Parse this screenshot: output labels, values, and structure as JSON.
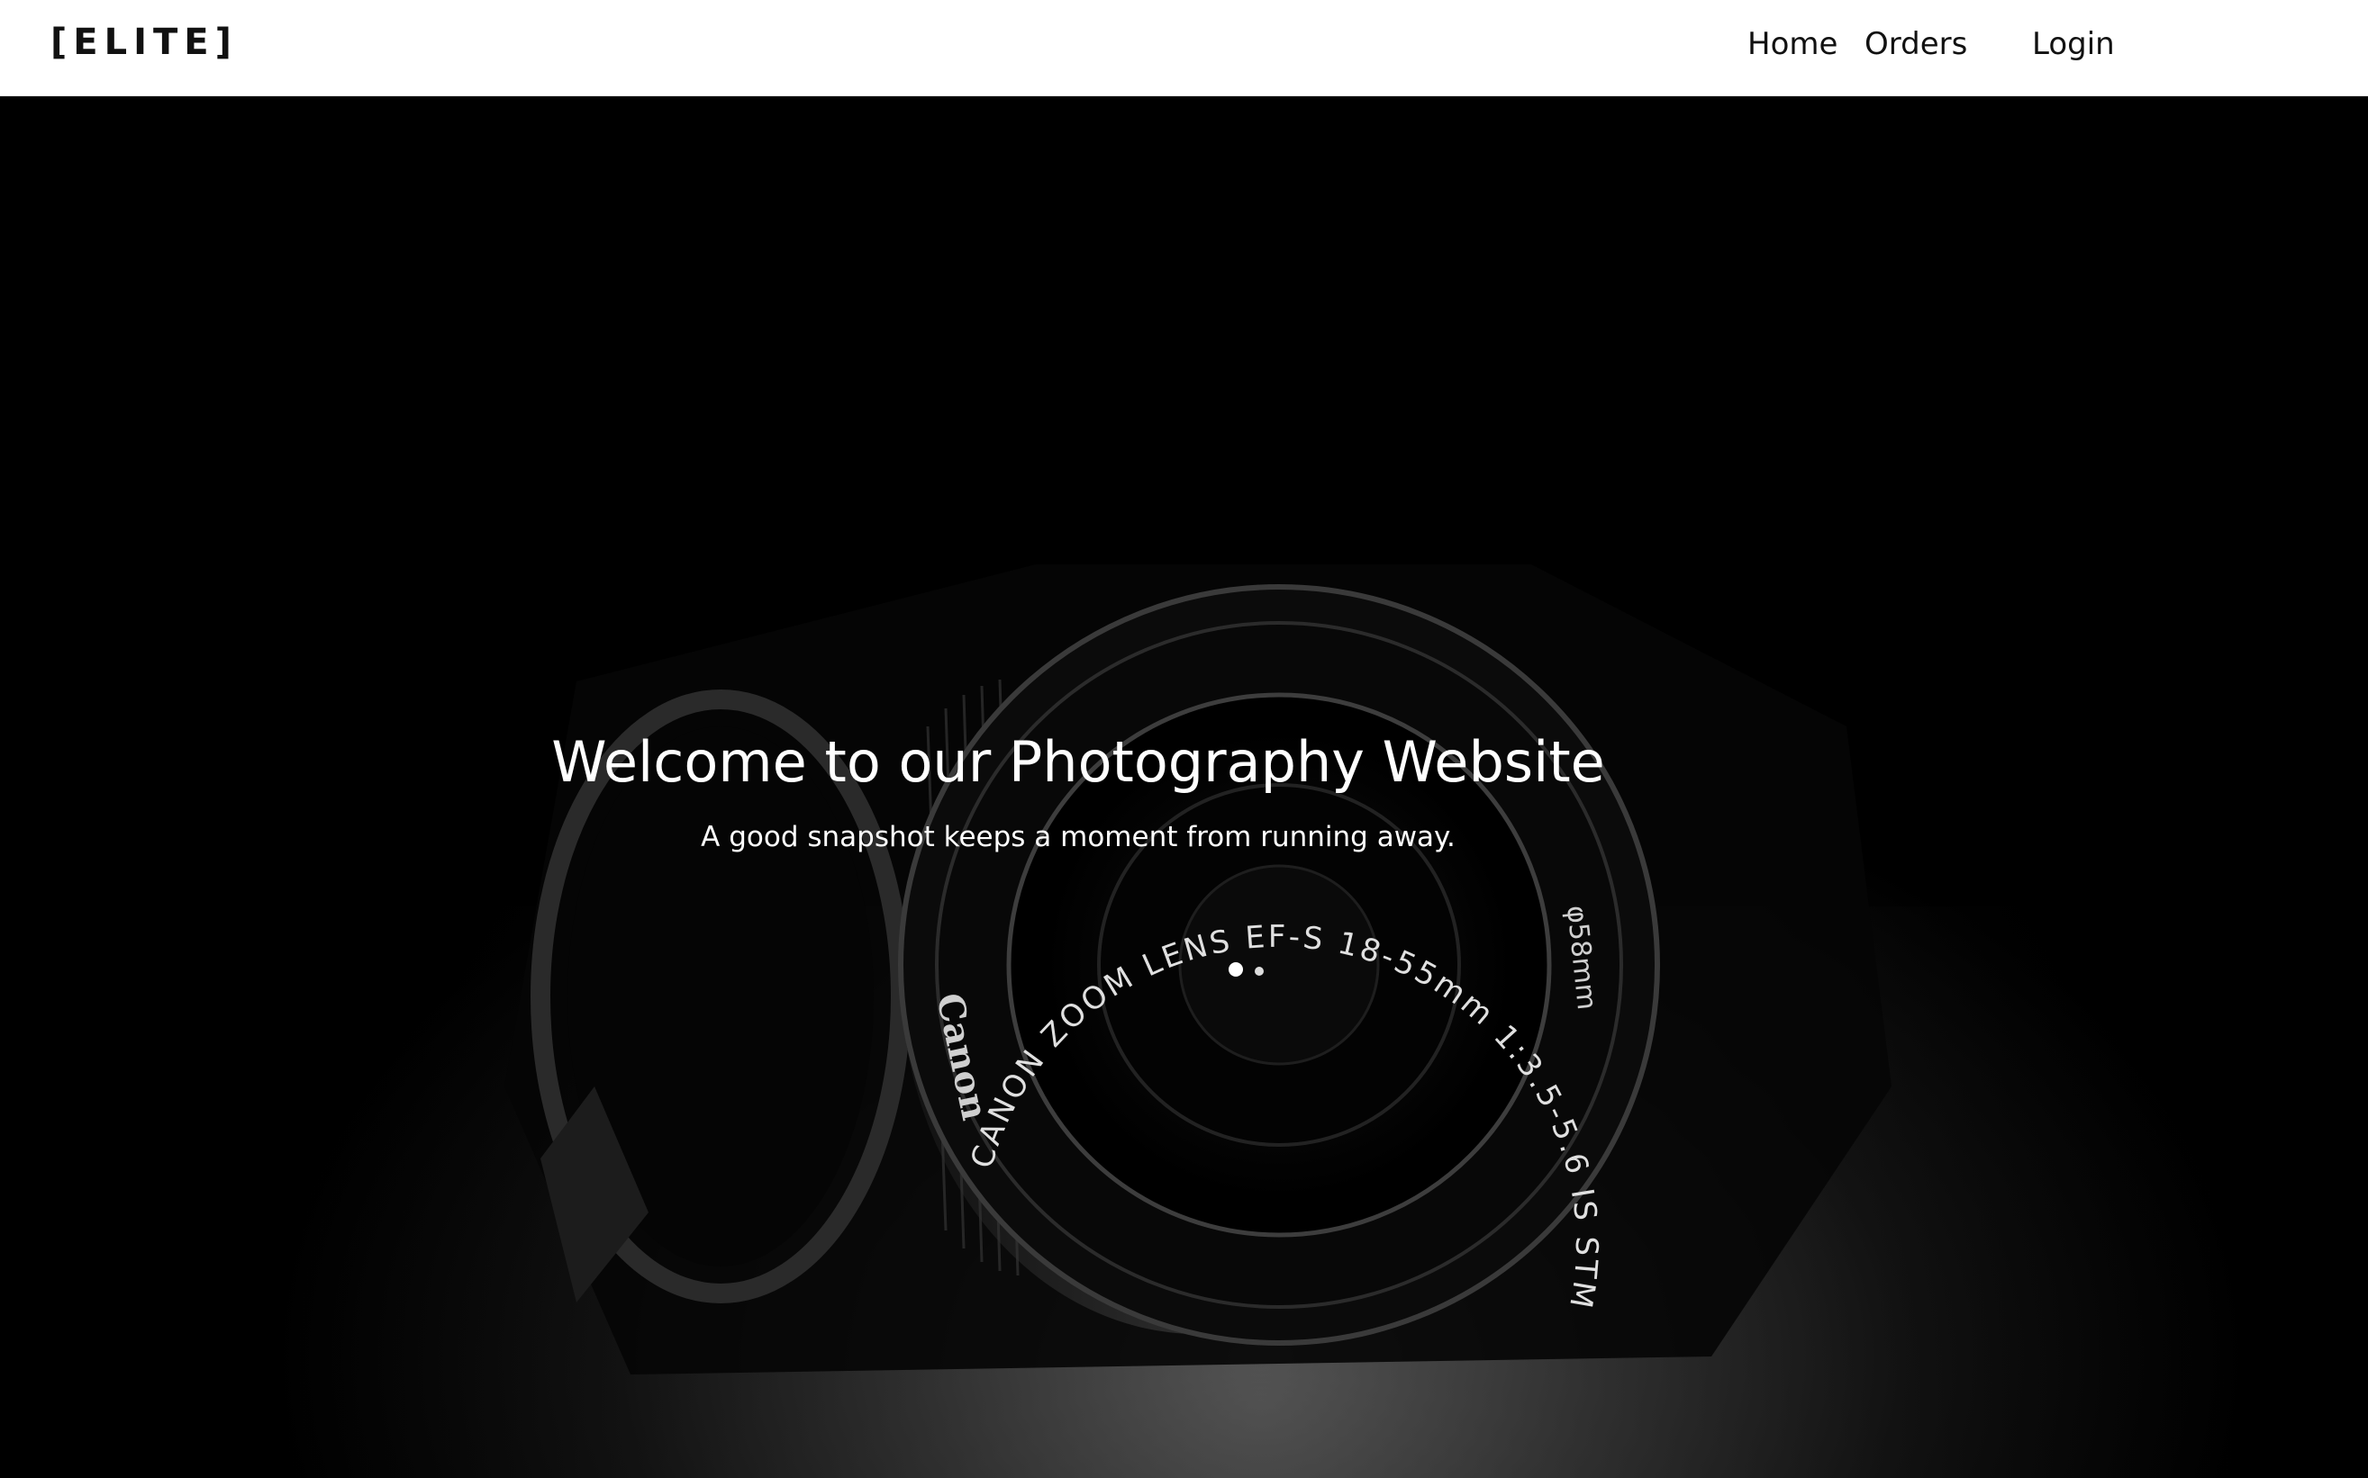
{
  "brand": {
    "logo_text": "[ELITE]"
  },
  "nav": {
    "items": [
      {
        "label": "Home"
      },
      {
        "label": "Orders"
      },
      {
        "label": "Login"
      }
    ]
  },
  "hero": {
    "title": "Welcome to our Photography Website",
    "subtitle": "A good snapshot keeps a moment from running away.",
    "background_image": "camera-lens-photo",
    "lens_ring_text": "CANON ZOOM LENS EF-S 18-55mm 1:3.5-5.6 IS STM",
    "lens_side_text": "φ58mm",
    "camera_brand_text": "Canon"
  },
  "colors": {
    "navbar_bg": "#ffffff",
    "hero_bg": "#000000",
    "hero_text": "#ffffff",
    "nav_text": "#111111"
  }
}
